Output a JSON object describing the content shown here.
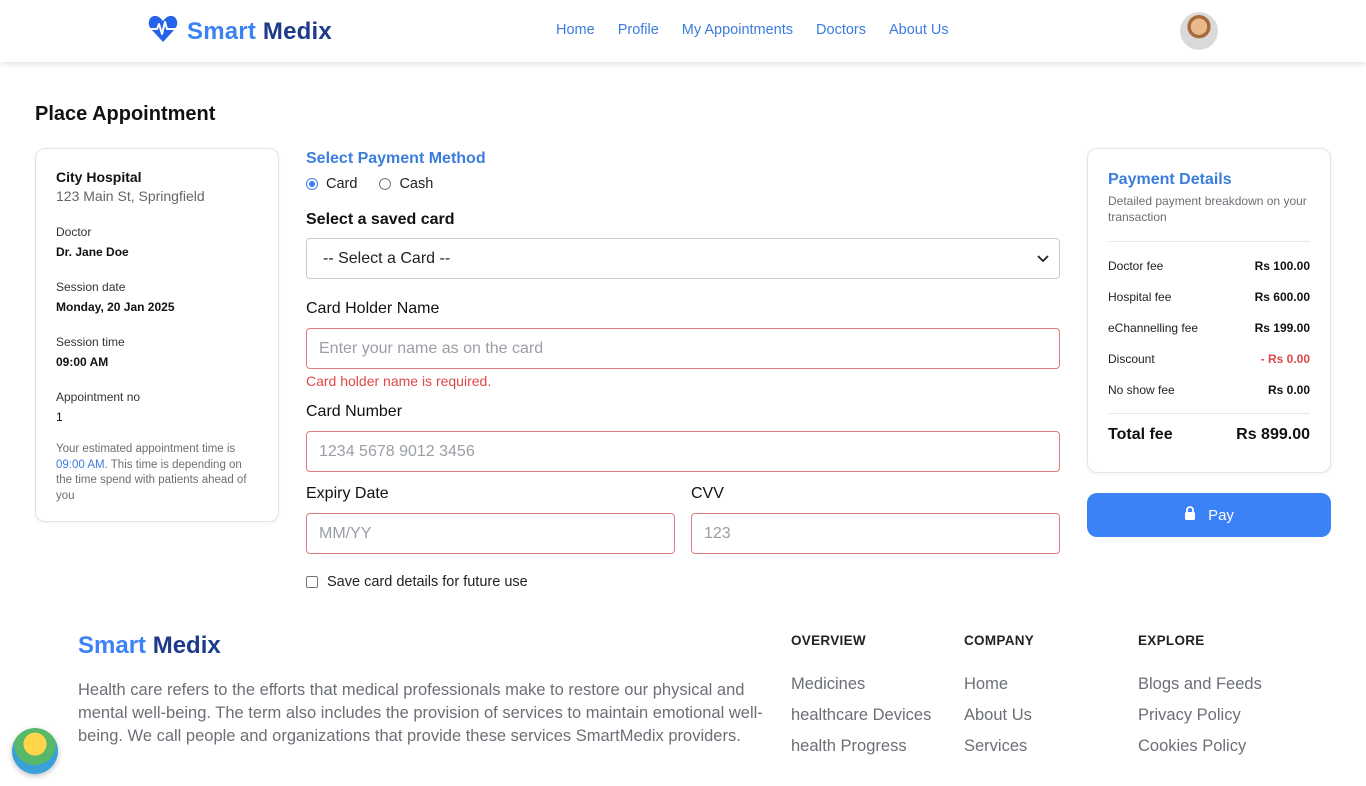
{
  "header": {
    "logo_smart": "Smart",
    "logo_medix": "Medix",
    "nav": [
      "Home",
      "Profile",
      "My Appointments",
      "Doctors",
      "About Us"
    ]
  },
  "page_title": "Place Appointment",
  "appointment": {
    "hospital_name": "City Hospital",
    "hospital_address": "123 Main St, Springfield",
    "doctor_label": "Doctor",
    "doctor_value": "Dr. Jane Doe",
    "session_date_label": "Session date",
    "session_date_value": "Monday, 20 Jan 2025",
    "session_time_label": "Session time",
    "session_time_value": "09:00 AM",
    "appointment_no_label": "Appointment no",
    "appointment_no_value": "1",
    "note_prefix": "Your estimated appointment time is ",
    "note_time": "09:00 AM",
    "note_suffix": ". This time is depending on the time spend with patients ahead of you"
  },
  "payment_form": {
    "method_title": "Select Payment Method",
    "method_card": "Card",
    "method_cash": "Cash",
    "selected_method": "Card",
    "saved_card_title": "Select a saved card",
    "saved_card_selected": "-- Select a Card --",
    "card_holder_label": "Card Holder Name",
    "card_holder_placeholder": "Enter your name as on the card",
    "card_holder_error": "Card holder name is required.",
    "card_number_label": "Card Number",
    "card_number_placeholder": "1234 5678 9012 3456",
    "expiry_label": "Expiry Date",
    "expiry_placeholder": "MM/YY",
    "cvv_label": "CVV",
    "cvv_placeholder": "123",
    "save_card_label": "Save card details for future use"
  },
  "payment_details": {
    "title": "Payment Details",
    "subtitle": "Detailed payment breakdown on your transaction",
    "fees": [
      {
        "label": "Doctor fee",
        "amount": "Rs 100.00"
      },
      {
        "label": "Hospital fee",
        "amount": "Rs 600.00"
      },
      {
        "label": "eChannelling fee",
        "amount": "Rs 199.00"
      },
      {
        "label": "Discount",
        "amount": "- Rs 0.00"
      },
      {
        "label": "No show fee",
        "amount": "Rs 0.00"
      }
    ],
    "total_label": "Total fee",
    "total_amount": "Rs 899.00",
    "pay_button": "Pay"
  },
  "footer": {
    "logo_smart": "Smart",
    "logo_medix": "Medix",
    "description": "Health care refers to the efforts that medical professionals make to restore our physical and mental well-being. The term also includes the provision of services to maintain emotional well-being. We call people and organizations that provide these services SmartMedix providers.",
    "columns": [
      {
        "title": "OVERVIEW",
        "links": [
          "Medicines",
          "healthcare Devices",
          "health Progress"
        ]
      },
      {
        "title": "COMPANY",
        "links": [
          "Home",
          "About Us",
          "Services"
        ]
      },
      {
        "title": "EXPLORE",
        "links": [
          "Blogs and Feeds",
          "Privacy Policy",
          "Cookies Policy"
        ]
      }
    ]
  },
  "colors": {
    "primary": "#3b82f6",
    "link": "#3b7ddd",
    "brand_dark": "#1e3a8a",
    "error": "#e04848"
  }
}
